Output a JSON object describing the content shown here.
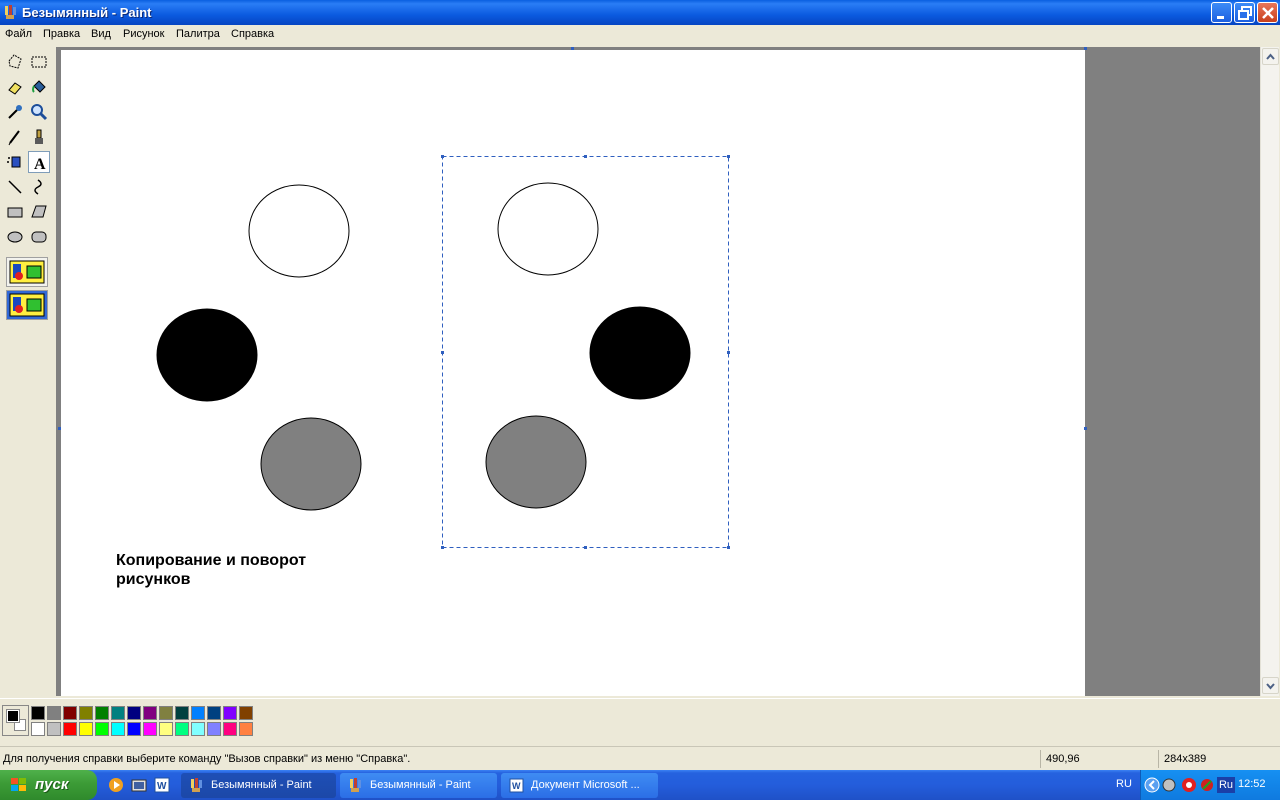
{
  "window": {
    "title": "Безымянный - Paint"
  },
  "menu": [
    "Файл",
    "Правка",
    "Вид",
    "Рисунок",
    "Палитра",
    "Справка"
  ],
  "tools": [
    "free-select",
    "rect-select",
    "eraser",
    "fill",
    "color-picker",
    "magnifier",
    "pencil",
    "brush",
    "airbrush",
    "text",
    "line",
    "curve",
    "rectangle",
    "polygon",
    "ellipse",
    "rounded-rectangle"
  ],
  "active_tool": "text",
  "canvas": {
    "caption_line1": "Копирование и поворот",
    "caption_line2": "рисунков",
    "shape_colors": {
      "white": "#ffffff",
      "black": "#000000",
      "gray": "#808080"
    }
  },
  "palette": {
    "foreground": "#000000",
    "background": "#ffffff",
    "row1": [
      "#000000",
      "#808080",
      "#800000",
      "#808000",
      "#008000",
      "#008080",
      "#000080",
      "#800080",
      "#808040",
      "#004040",
      "#0080ff",
      "#004080",
      "#8000ff",
      "#804000"
    ],
    "row2": [
      "#ffffff",
      "#c0c0c0",
      "#ff0000",
      "#ffff00",
      "#00ff00",
      "#00ffff",
      "#0000ff",
      "#ff00ff",
      "#ffff80",
      "#00ff80",
      "#80ffff",
      "#8080ff",
      "#ff0080",
      "#ff8040"
    ]
  },
  "status": {
    "help": "Для получения справки выберите команду \"Вызов справки\" из меню \"Справка\".",
    "coords": "490,96",
    "size": "284x389"
  },
  "taskbar": {
    "start": "пуск",
    "tasks": [
      "Безымянный - Paint",
      "Безымянный - Paint",
      "Документ Microsoft ..."
    ],
    "lang": "RU",
    "tray_lang": "Ru",
    "clock": "12:52"
  }
}
